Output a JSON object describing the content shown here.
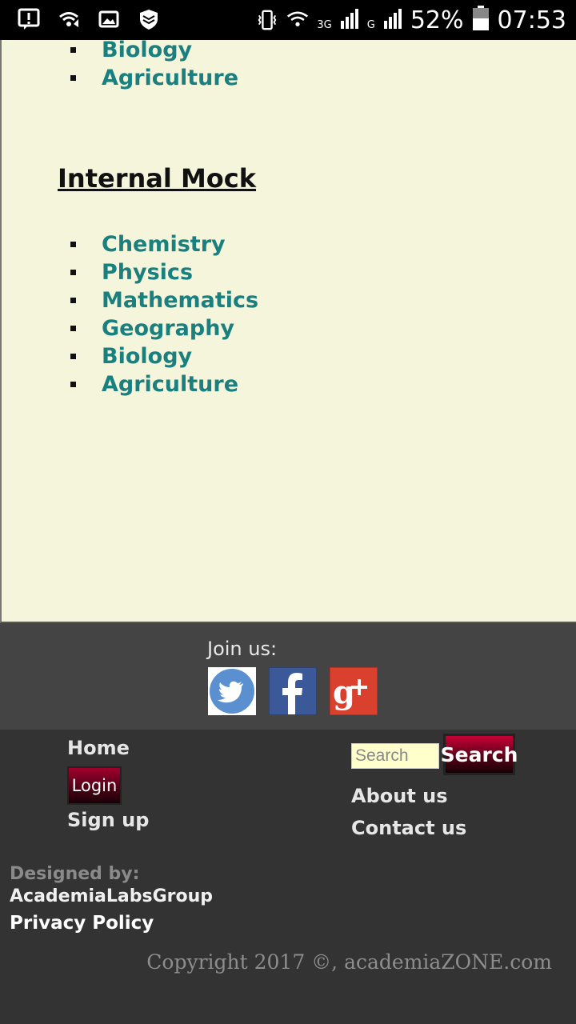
{
  "status_bar": {
    "battery": "52%",
    "time": "07:53",
    "network_1": "3G",
    "network_2": "G",
    "icons": [
      "alert-icon",
      "wifi-signal-icon",
      "image-icon",
      "shield-icon",
      "vibrate-icon",
      "wifi-icon",
      "signal-icon",
      "battery-icon"
    ]
  },
  "content": {
    "top_list": [
      "Biology",
      "Agriculture"
    ],
    "section_title": "Internal Mock",
    "mock_list": [
      "Chemistry",
      "Physics",
      "Mathematics",
      "Geography",
      "Biology",
      "Agriculture"
    ],
    "link_color": "#1a7f7f",
    "background": "#f5f5dc"
  },
  "join": {
    "label": "Join us:",
    "social": [
      "twitter-icon",
      "facebook-icon",
      "google-plus-icon"
    ]
  },
  "footer": {
    "home": "Home",
    "login": "Login",
    "signup": "Sign up",
    "search_placeholder": "Search",
    "search_button": "Search",
    "about": "About us",
    "contact": "Contact us",
    "designed_by": "Designed by:",
    "designer": "AcademiaLabsGroup",
    "privacy": "Privacy Policy",
    "copyright": "Copyright 2017 ©, academiaZONE.com"
  }
}
